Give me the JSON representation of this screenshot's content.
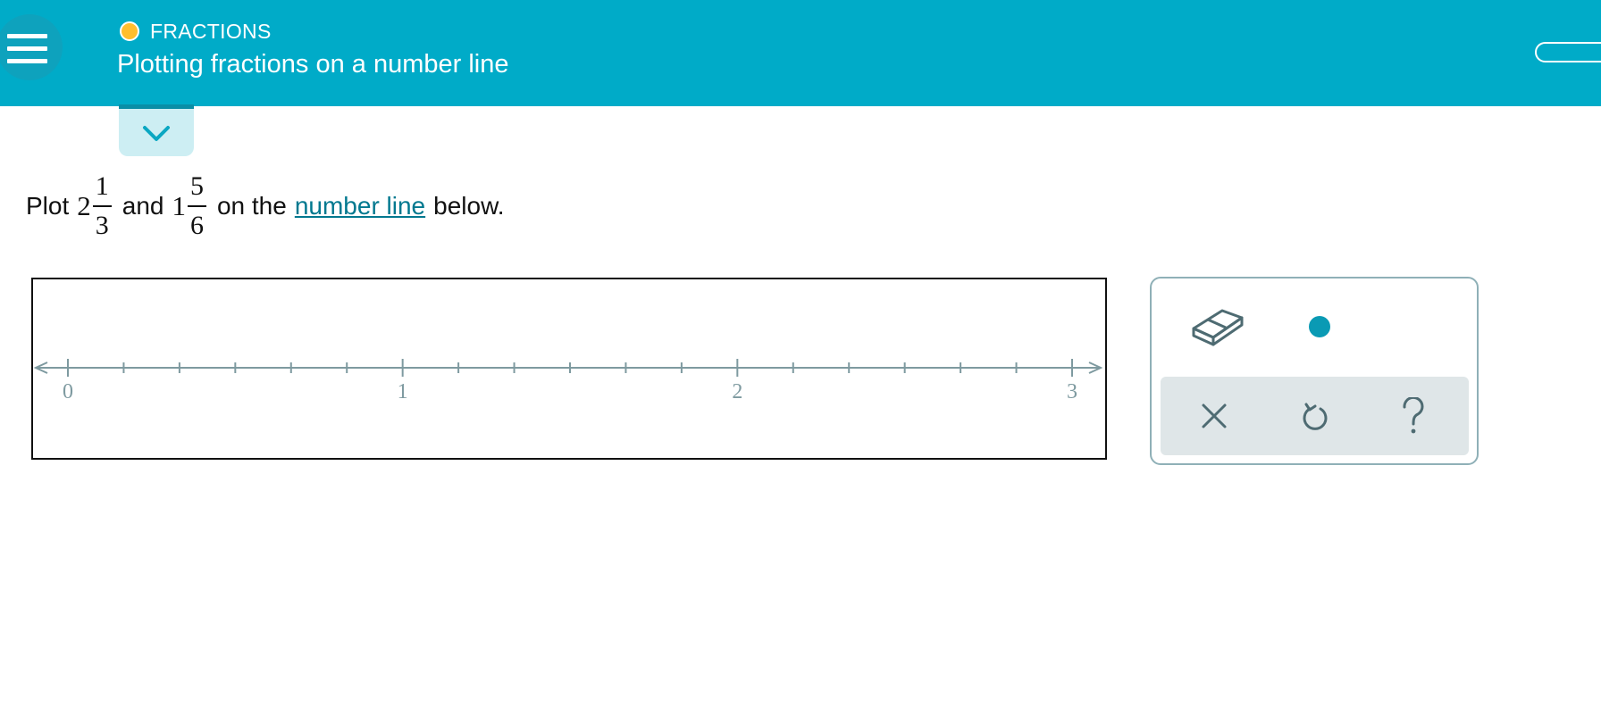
{
  "header": {
    "topic": "FRACTIONS",
    "title": "Plotting fractions on a number line",
    "topic_dot_color": "#ffbe2e",
    "background_color": "#00abc8"
  },
  "prompt": {
    "before": "Plot",
    "first_fraction": {
      "whole": "2",
      "numerator": "1",
      "denominator": "3"
    },
    "middle": "and",
    "second_fraction": {
      "whole": "1",
      "numerator": "5",
      "denominator": "6"
    },
    "after_1": "on the",
    "link_text": "number line",
    "after_2": "below."
  },
  "number_line": {
    "min": 0,
    "max": 3,
    "subdivisions_per_unit": 6,
    "labels": [
      "0",
      "1",
      "2",
      "3"
    ],
    "axis_color": "#7e9aa0"
  },
  "tools": {
    "eraser_icon": "eraser-icon",
    "point_icon": "point-icon",
    "clear_icon": "close-icon",
    "undo_icon": "undo-icon",
    "help_icon": "help-icon",
    "accent_color": "#0a9ab4"
  }
}
